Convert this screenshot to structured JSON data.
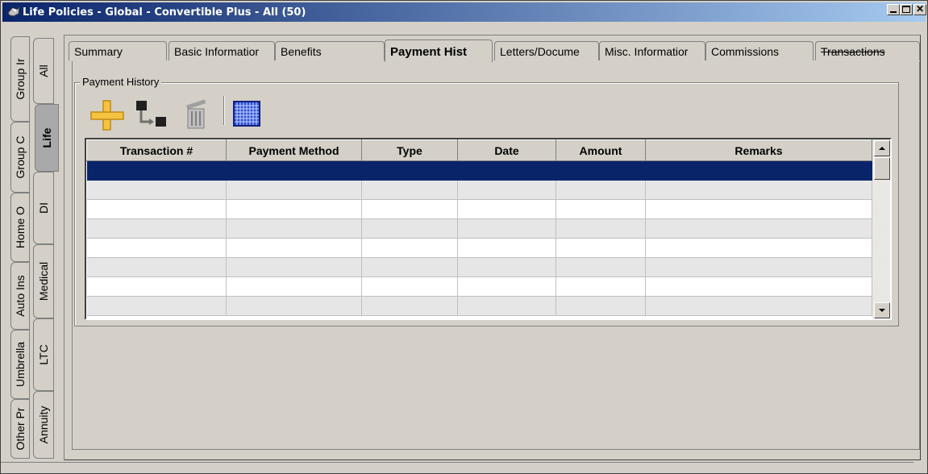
{
  "window": {
    "title": "Life Policies - Global - Convertible Plus - All (50)"
  },
  "left_tabs": {
    "outer": [
      "Group Ir",
      "Group C",
      "Home O",
      "Auto Ins",
      "Umbrella",
      "Other Pr"
    ],
    "inner": [
      "All",
      "Life",
      "DI",
      "Medical",
      "LTC",
      "Annuity"
    ],
    "active_inner": "Life"
  },
  "top_tabs": {
    "items": [
      "Summary",
      "Basic Informatior",
      "Benefits",
      "Payment Hist",
      "Letters/Docume",
      "Misc. Informatior",
      "Commissions",
      "Transactions"
    ],
    "active": "Payment Hist"
  },
  "payment_history": {
    "group_label": "Payment History",
    "toolbar": [
      "add-icon",
      "move-icon",
      "delete-icon",
      "grid-view-icon"
    ],
    "columns": [
      "Transaction #",
      "Payment Method",
      "Type",
      "Date",
      "Amount",
      "Remarks"
    ],
    "row_count": 8,
    "selected_row": 0
  },
  "colors": {
    "title_start": "#0a246a",
    "title_end": "#a6caf0",
    "selection": "#0a246a",
    "face": "#d4d0c8"
  }
}
